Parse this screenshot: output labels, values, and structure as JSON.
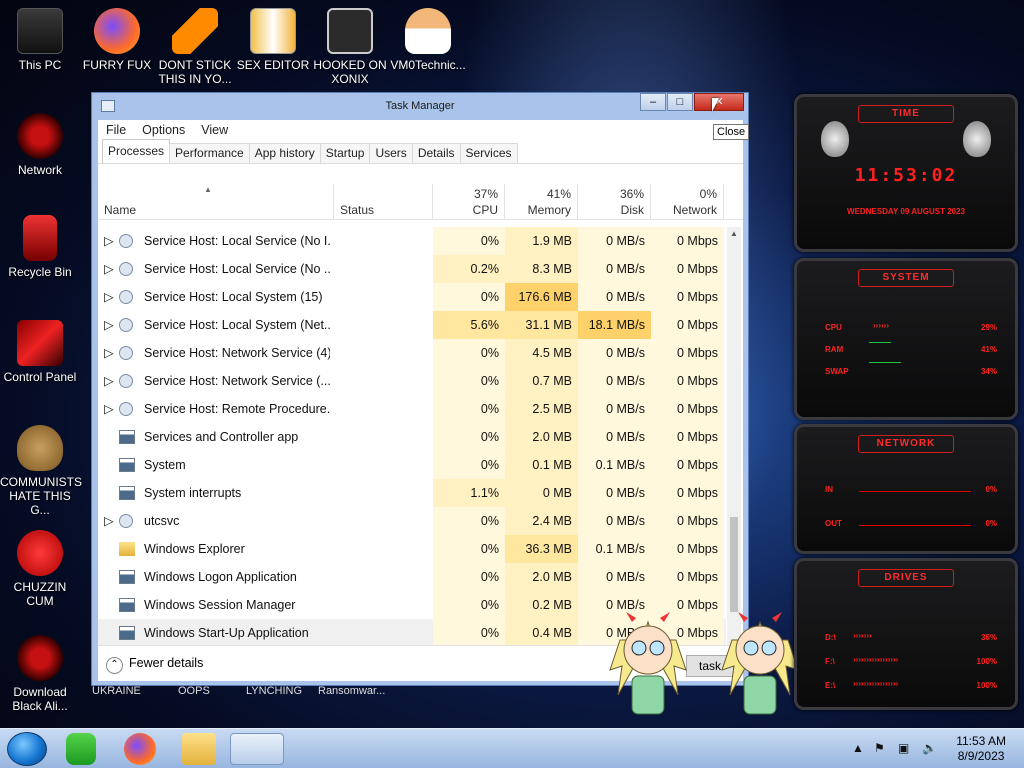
{
  "desktop": {
    "icons": [
      {
        "label": "This PC"
      },
      {
        "label": "FURRY FUX"
      },
      {
        "label": "DONT STICK\nTHIS IN YO..."
      },
      {
        "label": "SEX EDITOR"
      },
      {
        "label": "HOOKED ON\nXONIX"
      },
      {
        "label": "VM0Technic..."
      },
      {
        "label": "Network"
      },
      {
        "label": "Recycle Bin"
      },
      {
        "label": "Control Panel"
      },
      {
        "label": "COMMUNISTS\nHATE THIS G..."
      },
      {
        "label": "CHUZZIN\nCUM"
      },
      {
        "label": "Download\nBlack Ali..."
      }
    ],
    "partial_labels": [
      "UKRAINE",
      "OOPS",
      "LYNCHING",
      "Ransomwar..."
    ]
  },
  "window": {
    "title": "Task Manager",
    "close_tooltip": "Close",
    "menu": [
      "File",
      "Options",
      "View"
    ],
    "tabs": [
      "Processes",
      "Performance",
      "App history",
      "Startup",
      "Users",
      "Details",
      "Services"
    ],
    "active_tab": "Processes",
    "columns": {
      "name": "Name",
      "status": "Status",
      "cpu": {
        "pct": "37%",
        "label": "CPU"
      },
      "memory": {
        "pct": "41%",
        "label": "Memory"
      },
      "disk": {
        "pct": "36%",
        "label": "Disk"
      },
      "network": {
        "pct": "0%",
        "label": "Network"
      }
    },
    "rows": [
      {
        "expand": true,
        "icon": "gear-icon",
        "name": "Service Host: Local Service (No I...",
        "cpu": "0%",
        "mem": "1.9 MB",
        "disk": "0 MB/s",
        "net": "0 Mbps"
      },
      {
        "expand": true,
        "icon": "gear-icon",
        "name": "Service Host: Local Service (No ...",
        "cpu": "0.2%",
        "mem": "8.3 MB",
        "disk": "0 MB/s",
        "net": "0 Mbps"
      },
      {
        "expand": true,
        "icon": "gear-icon",
        "name": "Service Host: Local System (15)",
        "cpu": "0%",
        "mem": "176.6 MB",
        "disk": "0 MB/s",
        "net": "0 Mbps"
      },
      {
        "expand": true,
        "icon": "gear-icon",
        "name": "Service Host: Local System (Net...",
        "cpu": "5.6%",
        "mem": "31.1 MB",
        "disk": "18.1 MB/s",
        "net": "0 Mbps"
      },
      {
        "expand": true,
        "icon": "gear-icon",
        "name": "Service Host: Network Service (4)",
        "cpu": "0%",
        "mem": "4.5 MB",
        "disk": "0 MB/s",
        "net": "0 Mbps"
      },
      {
        "expand": true,
        "icon": "gear-icon",
        "name": "Service Host: Network Service (...",
        "cpu": "0%",
        "mem": "0.7 MB",
        "disk": "0 MB/s",
        "net": "0 Mbps"
      },
      {
        "expand": true,
        "icon": "gear-icon",
        "name": "Service Host: Remote Procedure...",
        "cpu": "0%",
        "mem": "2.5 MB",
        "disk": "0 MB/s",
        "net": "0 Mbps"
      },
      {
        "expand": false,
        "icon": "app-window-icon",
        "name": "Services and Controller app",
        "cpu": "0%",
        "mem": "2.0 MB",
        "disk": "0 MB/s",
        "net": "0 Mbps"
      },
      {
        "expand": false,
        "icon": "app-window-icon",
        "name": "System",
        "cpu": "0%",
        "mem": "0.1 MB",
        "disk": "0.1 MB/s",
        "net": "0 Mbps"
      },
      {
        "expand": false,
        "icon": "app-window-icon",
        "name": "System interrupts",
        "cpu": "1.1%",
        "mem": "0 MB",
        "disk": "0 MB/s",
        "net": "0 Mbps"
      },
      {
        "expand": true,
        "icon": "gear-icon",
        "name": "utcsvc",
        "cpu": "0%",
        "mem": "2.4 MB",
        "disk": "0 MB/s",
        "net": "0 Mbps"
      },
      {
        "expand": false,
        "icon": "folder-icon",
        "name": "Windows Explorer",
        "cpu": "0%",
        "mem": "36.3 MB",
        "disk": "0.1 MB/s",
        "net": "0 Mbps"
      },
      {
        "expand": false,
        "icon": "app-window-icon",
        "name": "Windows Logon Application",
        "cpu": "0%",
        "mem": "2.0 MB",
        "disk": "0 MB/s",
        "net": "0 Mbps"
      },
      {
        "expand": false,
        "icon": "app-window-icon",
        "name": "Windows Session Manager",
        "cpu": "0%",
        "mem": "0.2 MB",
        "disk": "0 MB/s",
        "net": "0 Mbps"
      },
      {
        "expand": false,
        "icon": "app-window-icon",
        "name": "Windows Start-Up Application",
        "cpu": "0%",
        "mem": "0.4 MB",
        "disk": "0 MB/s",
        "net": "0 Mbps"
      }
    ],
    "fewer_details": "Fewer details",
    "end_task": "End task",
    "end_task_visible": "task"
  },
  "widget": {
    "time_header": "TIME",
    "time": "11:53:02",
    "date": "WEDNESDAY 09 AUGUST 2023",
    "system_header": "SYSTEM",
    "system": [
      {
        "label": "CPU",
        "value": "29%"
      },
      {
        "label": "RAM",
        "value": "41%"
      },
      {
        "label": "SWAP",
        "value": "34%"
      }
    ],
    "network_header": "NETWORK",
    "network": [
      {
        "label": "IN",
        "value": "0%"
      },
      {
        "label": "OUT",
        "value": "0%"
      }
    ],
    "drives_header": "DRIVES",
    "drives": [
      {
        "label": "D:\\",
        "value": "36%"
      },
      {
        "label": "F:\\",
        "value": "100%"
      },
      {
        "label": "E:\\",
        "value": "100%"
      }
    ]
  },
  "taskbar": {
    "time": "11:53 AM",
    "date": "8/9/2023",
    "items": [
      "start-orb",
      "green-app-icon",
      "firefox-icon",
      "file-explorer-icon",
      "task-manager-icon"
    ]
  },
  "colors": {
    "accent_red": "#ff2020",
    "cpu_highlight": "#fff4c4",
    "mem_highlight": "#ffe8a8",
    "disk_highlight": "#ffd77a"
  }
}
